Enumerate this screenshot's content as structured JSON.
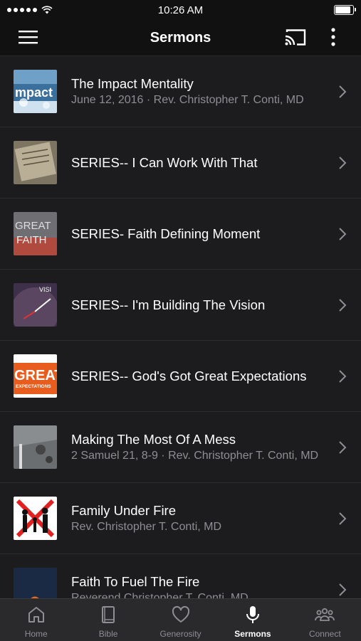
{
  "status": {
    "time": "10:26 AM",
    "battery_level": 0.95
  },
  "header": {
    "title": "Sermons"
  },
  "sermons": [
    {
      "title": "The Impact Mentality",
      "subtitle": "June 12, 2016 · Rev. Christopher T. Conti, MD",
      "thumb_text": "mpact"
    },
    {
      "title": "SERIES-- I Can Work With That",
      "subtitle": ""
    },
    {
      "title": "SERIES- Faith Defining Moment",
      "subtitle": "",
      "thumb_text": "GREAT FAITH"
    },
    {
      "title": "SERIES-- I'm Building The Vision",
      "subtitle": "",
      "thumb_text": "VISI"
    },
    {
      "title": "SERIES-- God's Got Great Expectations",
      "subtitle": "",
      "thumb_text": "GREAT",
      "thumb_text2": "EXPECTATIONS"
    },
    {
      "title": "Making The Most Of A Mess",
      "subtitle": "2 Samuel 21, 8-9 · Rev. Christopher T. Conti, MD"
    },
    {
      "title": "Family Under Fire",
      "subtitle": "Rev. Christopher T. Conti, MD"
    },
    {
      "title": "Faith To Fuel The Fire",
      "subtitle": "Reverend Christopher T. Conti, MD"
    }
  ],
  "tabs": [
    {
      "label": "Home",
      "icon": "home-icon"
    },
    {
      "label": "Bible",
      "icon": "bible-icon"
    },
    {
      "label": "Generosity",
      "icon": "heart-icon"
    },
    {
      "label": "Sermons",
      "icon": "microphone-icon"
    },
    {
      "label": "Connect",
      "icon": "people-icon"
    }
  ]
}
